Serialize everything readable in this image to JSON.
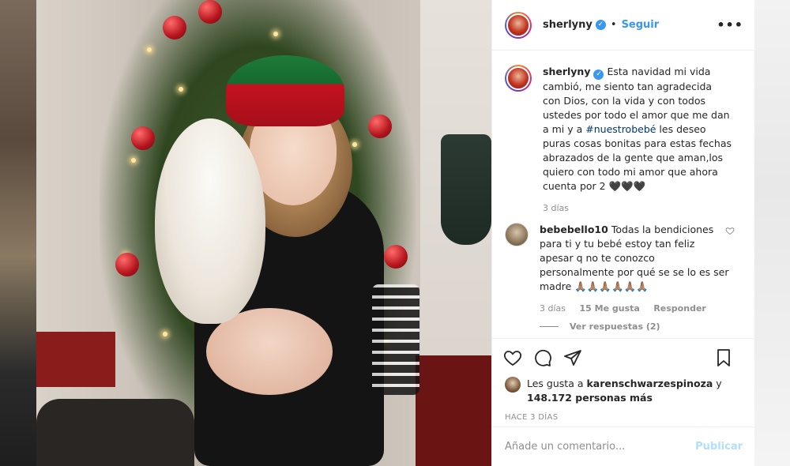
{
  "post": {
    "username": "sherlyny",
    "verified_glyph": "✓",
    "separator": "•",
    "follow_label": "Seguir",
    "more_label": "•••"
  },
  "caption": {
    "username": "sherlyny",
    "text_before": " Esta navidad mi vida cambió, me siento tan agradecida con Dios, con la vida y con todos ustedes por todo el amor que me dan a mi y a ",
    "hashtag": "#nuestrobebé",
    "text_after": " les deseo puras cosas bonitas para estas fechas abrazados de la gente que aman,los quiero con todo mi amor que ahora cuenta por 2 🖤🖤🖤",
    "time": "3 días"
  },
  "comment": {
    "username": "bebebello10",
    "text": " Todas la bendiciones para ti y tu bebé estoy tan feliz apesar q no te conozco personalmente por qué se se lo es ser madre 🙏🏽🙏🏽🙏🏽🙏🏽🙏🏽🙏🏽",
    "time": "3 días",
    "likes": "15 Me gusta",
    "reply_label": "Responder",
    "view_replies": "Ver respuestas (2)"
  },
  "likes": {
    "prefix": "Les gusta a ",
    "user": "karenschwarzespinoza",
    "middle": " y ",
    "count": "148.172 personas más"
  },
  "date": "HACE 3 DÍAS",
  "add_comment": {
    "placeholder": "Añade un comentario...",
    "publish_label": "Publicar"
  },
  "colors": {
    "link_blue": "#3897f0",
    "hashtag": "#00376b",
    "muted": "#8e8e8e",
    "publish_disabled": "#b2dffc"
  },
  "icons": [
    "heart-icon",
    "comment-icon",
    "share-icon",
    "bookmark-icon",
    "verified-icon",
    "more-icon"
  ]
}
